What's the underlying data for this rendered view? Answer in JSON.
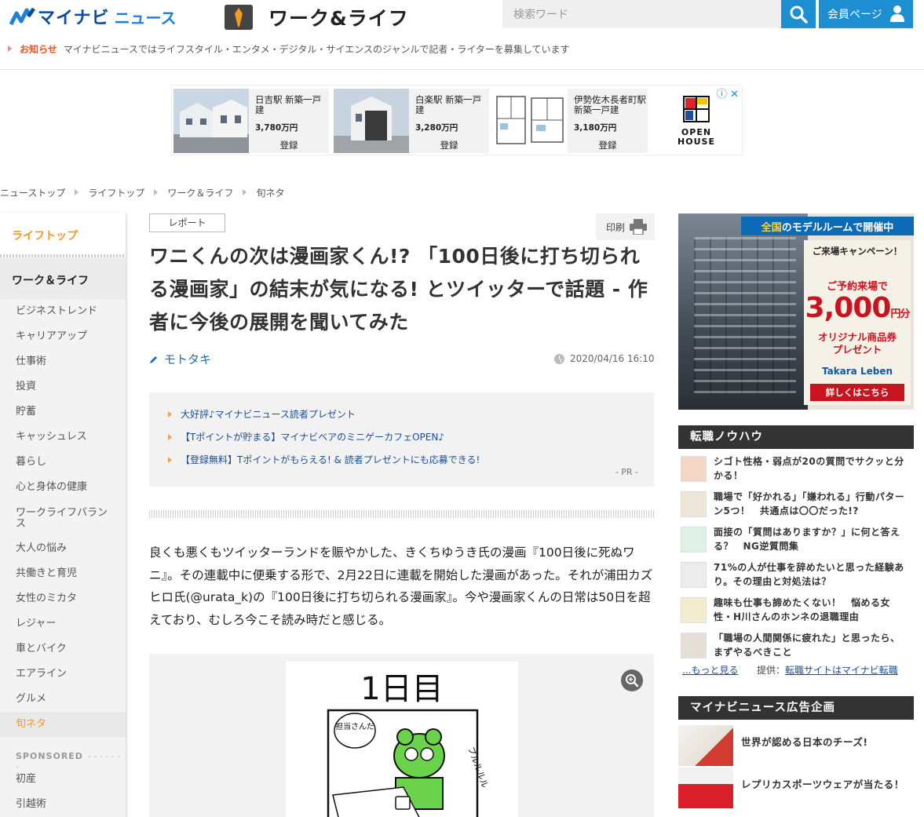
{
  "header": {
    "logo_text": "マイナビ",
    "logo_news": "ニュース",
    "section_title": "ワーク&ライフ",
    "search_placeholder": "検索ワード",
    "member_label": "会員ページ"
  },
  "notice": {
    "label": "お知らせ",
    "text": "マイナビニュースではライフスタイル・エンタメ・デジタル・サイエンスのジャンルで記者・ライターを募集しています"
  },
  "ad_banner": {
    "cards": [
      {
        "name": "日吉駅 新築一戸建",
        "price": "3,780万円",
        "cta": "登録"
      },
      {
        "name": "白楽駅 新築一戸建",
        "price": "3,280万円",
        "cta": "登録"
      },
      {
        "name": "伊勢佐木長者町駅 新築一戸建",
        "price": "3,180万円",
        "cta": "登録"
      }
    ],
    "brand": "OPEN HOUSE",
    "close_label": "ⓘ ✕"
  },
  "breadcrumb": [
    "ニューストップ",
    "ライフトップ",
    "ワーク＆ライフ",
    "旬ネタ"
  ],
  "left_nav": {
    "top": "ライフトップ",
    "section": "ワーク＆ライフ",
    "items": [
      "ビジネストレンド",
      "キャリアアップ",
      "仕事術",
      "投資",
      "貯蓄",
      "キャッシュレス",
      "暮らし",
      "心と身体の健康",
      "ワークライフバランス",
      "大人の悩み",
      "共働きと育児",
      "女性のミカタ",
      "レジャー",
      "車とバイク",
      "エアライン",
      "グルメ",
      "旬ネタ"
    ],
    "active_item": "旬ネタ",
    "sponsored_label": "SPONSORED",
    "sponsored_items": [
      "初産",
      "引越術"
    ]
  },
  "article": {
    "tag": "レポート",
    "print_label": "印刷",
    "title": "ワニくんの次は漫画家くん!? 「100日後に打ち切られる漫画家」の結末が気になる! とツイッターで話題 - 作者に今後の展開を聞いてみた",
    "author": "モトタキ",
    "date": "2020/04/16 16:10",
    "pr_links": [
      "大好評♪マイナビニュース読者プレゼント",
      "【Tポイントが貯まる】マイナビベアのミニゲーカフェOPEN♪",
      "【登録無料】Tポイントがもらえる! & 読者プレゼントにも応募できる!"
    ],
    "pr_tag": "- PR -",
    "body": "良くも悪くもツイッターランドを賑やかした、きくちゆうき氏の漫画『100日後に死ぬワニ』。その連載中に便乗する形で、2月22日に連載を開始した漫画があった。それが浦田カズヒロ氏(@urata_k)の『100日後に打ち切られる漫画家』。今や漫画家くんの日常は50日を超えており、むしろ今こそ読み時だと感じる。",
    "comic_day": "1日目",
    "comic_bubble": "担当さんだ",
    "comic_phone": "プルルルル"
  },
  "right_ad": {
    "top_strong": "全国",
    "top_rest": "のモデルルームで開催中",
    "campaign": "ご来場キャンペーン！",
    "reserve": "ご予約来場で",
    "amount": "3,000",
    "amount_unit": "円分",
    "gift": "オリジナル商品券\nプレゼント",
    "brand": "Takara Leben",
    "cta": "詳しくはこちら"
  },
  "knowhow": {
    "heading": "転職ノウハウ",
    "items": [
      "シゴト性格・弱点が20の質問でサクッと分かる！",
      "職場で「好かれる」「嫌われる」行動パターン5つ！　共通点は〇〇だった!?",
      "面接の「質問はありますか？」に何と答える？　NG逆質問集",
      "71%の人が仕事を辞めたいと思った経験あり。その理由と対処法は？",
      "趣味も仕事も諦めたくない！　悩める女性・H川さんのホンネの退職理由",
      "「職場の人間関係に疲れた」と思ったら、まずやるべきこと"
    ],
    "more": "...もっと見る",
    "credit_label": "提供：",
    "credit_link": "転職サイトはマイナビ転職"
  },
  "ad_kikaku": {
    "heading": "マイナビニュース広告企画",
    "items": [
      "世界が認める日本のチーズ!",
      "レプリカスポーツウェアが当たる！"
    ]
  }
}
